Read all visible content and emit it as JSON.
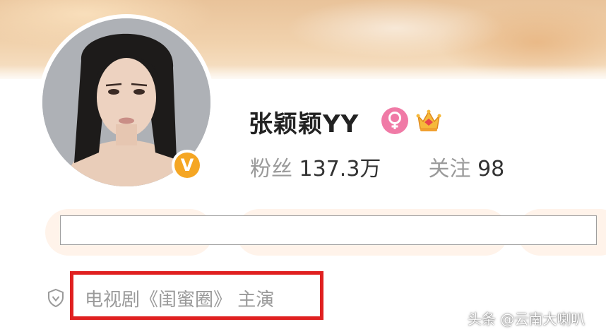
{
  "profile": {
    "name": "张颖颖YY",
    "verified_badge": "V",
    "gender_icon": "female-icon",
    "member_icon": "crown-icon",
    "stats": {
      "followers_label": "粉丝",
      "followers_value": "137.3万",
      "following_label": "关注",
      "following_value": "98"
    },
    "intro": "电视剧《闺蜜圈》 主演"
  },
  "watermark": "头条 @云南大喇叭",
  "colors": {
    "accent_red": "#e02020",
    "verified_gold": "#f5a623",
    "gender_pink": "#f07aa6",
    "pill_bg": "#fff3ea"
  }
}
